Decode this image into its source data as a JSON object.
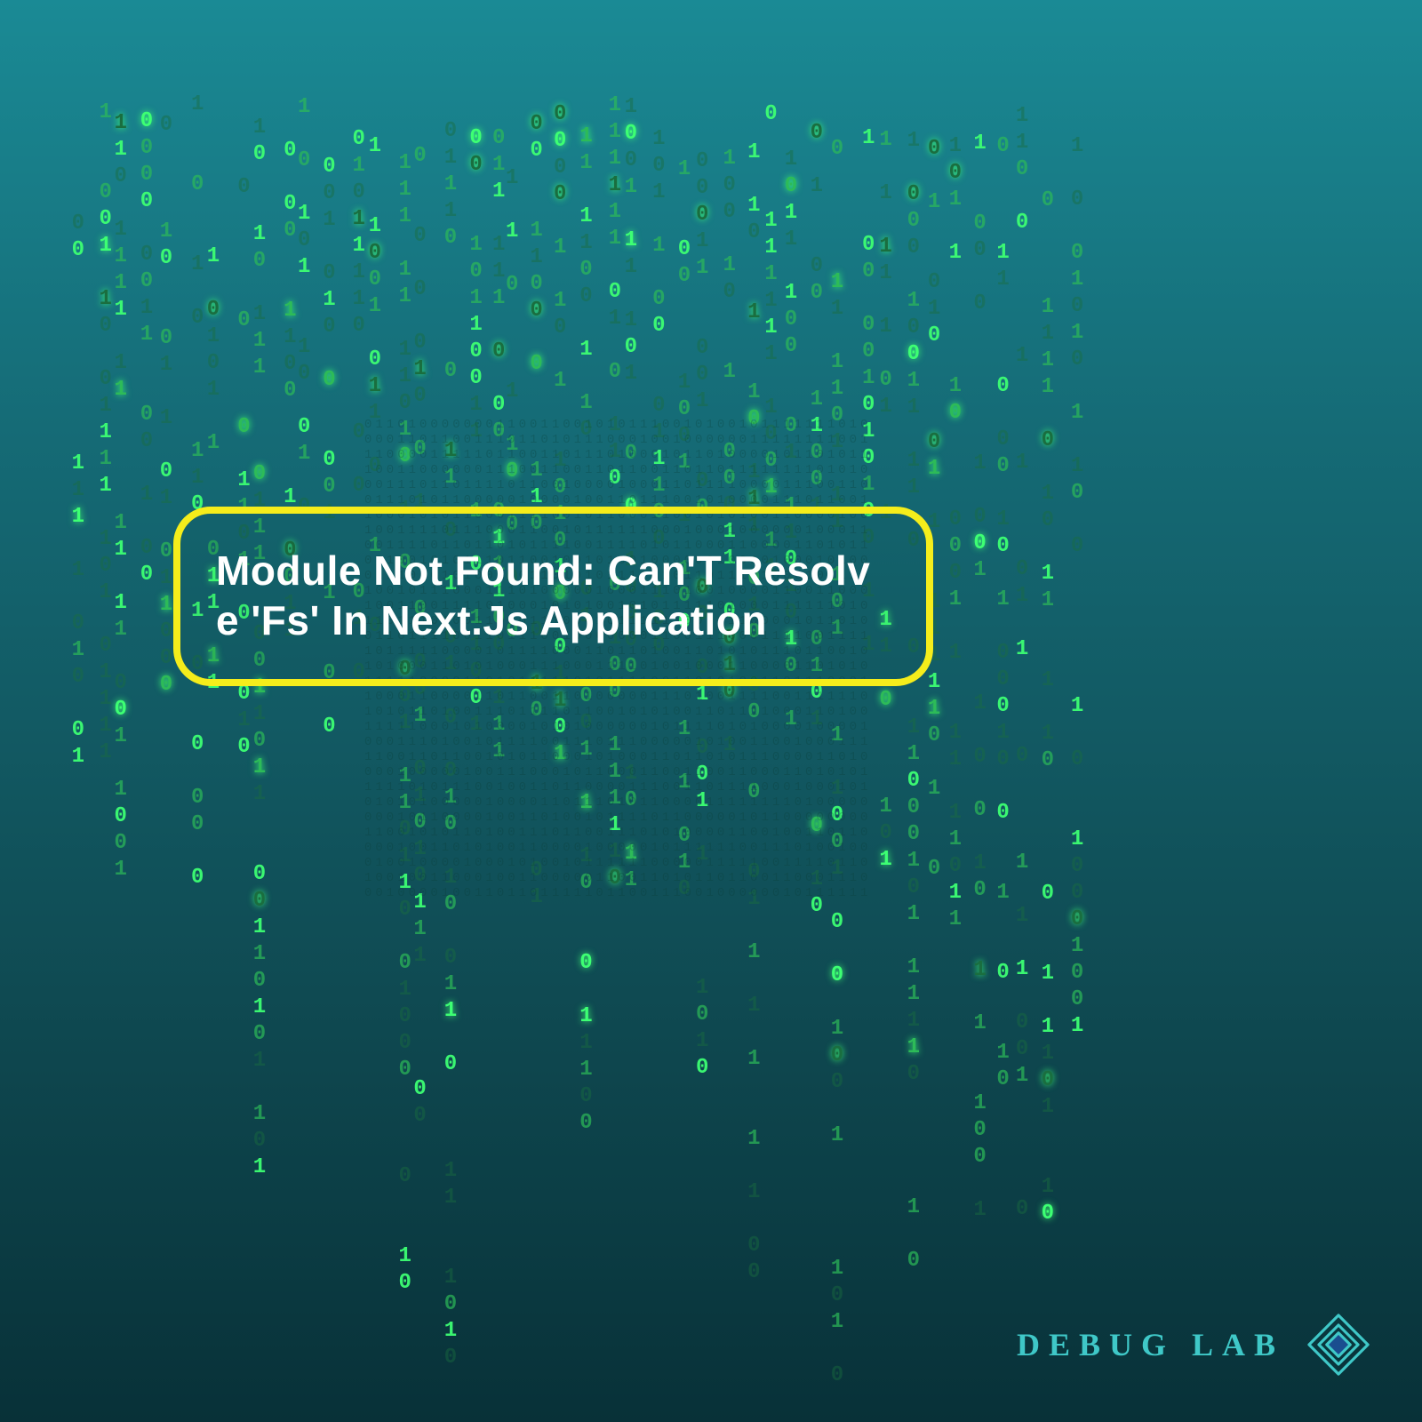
{
  "title": "Module Not Found: Can'T Resolve 'Fs' In Next.Js Application",
  "brand": "DEBUG LAB",
  "matrix_chars": [
    "0",
    "1"
  ],
  "colors": {
    "accent_border": "#f5ed1b",
    "matrix_bright": "#3dff73",
    "matrix_mid": "#2dbb58",
    "matrix_dim": "#1a6e3f",
    "brand": "#3fc8c8"
  }
}
